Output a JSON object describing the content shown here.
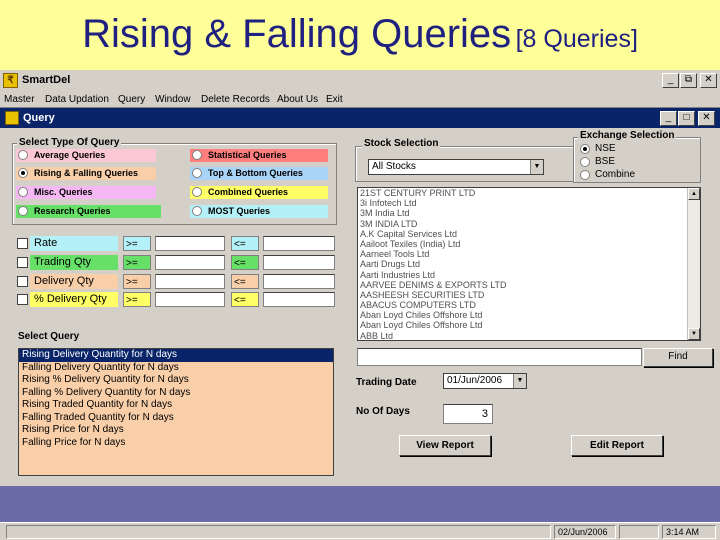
{
  "slide": {
    "title": "Rising & Falling Queries",
    "subtitle": "[8 Queries]"
  },
  "app": {
    "title": "SmartDel",
    "logo_glyph": "₹",
    "controls": [
      "_",
      "⧉",
      "✕"
    ],
    "menu": [
      "Master",
      "Data Updation",
      "Query",
      "Window",
      "Delete Records",
      "About Us",
      "Exit"
    ]
  },
  "dialog": {
    "title": "Query",
    "controls": [
      "_",
      "□",
      "✕"
    ],
    "query_type_legend": "Select Type Of Query",
    "query_types": [
      {
        "label": "Average Queries",
        "color": "#fcc8d6",
        "selected": false
      },
      {
        "label": "Statistical Queries",
        "color": "#ff7e7e",
        "selected": false
      },
      {
        "label": "Rising & Falling Queries",
        "color": "#f9cfa9",
        "selected": true
      },
      {
        "label": "Top & Bottom Queries",
        "color": "#aad4f7",
        "selected": false
      },
      {
        "label": "Misc. Queries",
        "color": "#f5b8f5",
        "selected": false
      },
      {
        "label": "Combined Queries",
        "color": "#ffff66",
        "selected": false
      },
      {
        "label": "Research Queries",
        "color": "#66e066",
        "selected": false
      },
      {
        "label": "MOST Queries",
        "color": "#b4f0f7",
        "selected": false
      }
    ],
    "filters": [
      {
        "label": "Rate",
        "color": "#b4f0f7",
        "op1": ">=",
        "op2": "<="
      },
      {
        "label": "Trading Qty",
        "color": "#66e066",
        "op1": ">=",
        "op2": "<="
      },
      {
        "label": "Delivery Qty",
        "color": "#f9cfa9",
        "op1": ">=",
        "op2": "<="
      },
      {
        "label": "% Delivery Qty",
        "color": "#ffff66",
        "op1": ">=",
        "op2": "<="
      }
    ],
    "select_query_label": "Select Query",
    "queries": [
      "Rising Delivery Quantity for N days",
      "Falling Delivery Quantity for N days",
      "Rising % Delivery Quantity for N days",
      "Falling % Delivery Quantity for N days",
      "Rising Traded Quantity for N days",
      "Falling Traded Quantity for N days",
      "Rising Price for N days",
      "Falling Price for N days"
    ],
    "stock_selection": {
      "legend": "Stock Selection",
      "value": "All Stocks",
      "stocks": [
        "21ST CENTURY PRINT LTD",
        "3i Infotech Ltd",
        "3M India Ltd",
        "3M INDIA LTD",
        "A.K Capital Services Ltd",
        "Aailoot Texiles (India) Ltd",
        "Aarneel Tools Ltd",
        "Aarti Drugs Ltd",
        "Aarti Industries Ltd",
        "AARVEE DENIMS & EXPORTS LTD",
        "AASHEESH SECURITIES LTD",
        "ABACUS COMPUTERS LTD",
        "Aban Loyd Chiles Offshore Ltd",
        "Aban Loyd Chiles Offshore Ltd",
        "ABB Ltd"
      ]
    },
    "exchange": {
      "legend": "Exchange Selection",
      "options": [
        {
          "label": "NSE",
          "selected": true
        },
        {
          "label": "BSE",
          "selected": false
        },
        {
          "label": "Combine",
          "selected": false
        }
      ]
    },
    "find_label": "Find",
    "trading_date_label": "Trading Date",
    "trading_date": "01/Jun/2006",
    "no_of_days_label": "No Of Days",
    "no_of_days": "3",
    "view_report": "View Report",
    "edit_report": "Edit Report"
  },
  "status": {
    "date": "02/Jun/2006",
    "time": "3:14 AM"
  }
}
